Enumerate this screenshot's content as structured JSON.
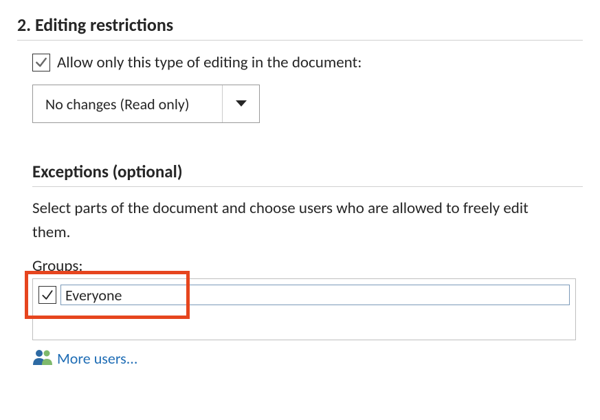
{
  "section2": {
    "heading": "2. Editing restrictions",
    "allow_label": "Allow only this type of editing in the document:",
    "dropdown_value": "No changes (Read only)"
  },
  "exceptions": {
    "heading": "Exceptions (optional)",
    "description": "Select parts of the document and choose users who are allowed to freely edit them.",
    "groups_label": "Groups:",
    "group_item": "Everyone",
    "more_users_label": "More users..."
  }
}
